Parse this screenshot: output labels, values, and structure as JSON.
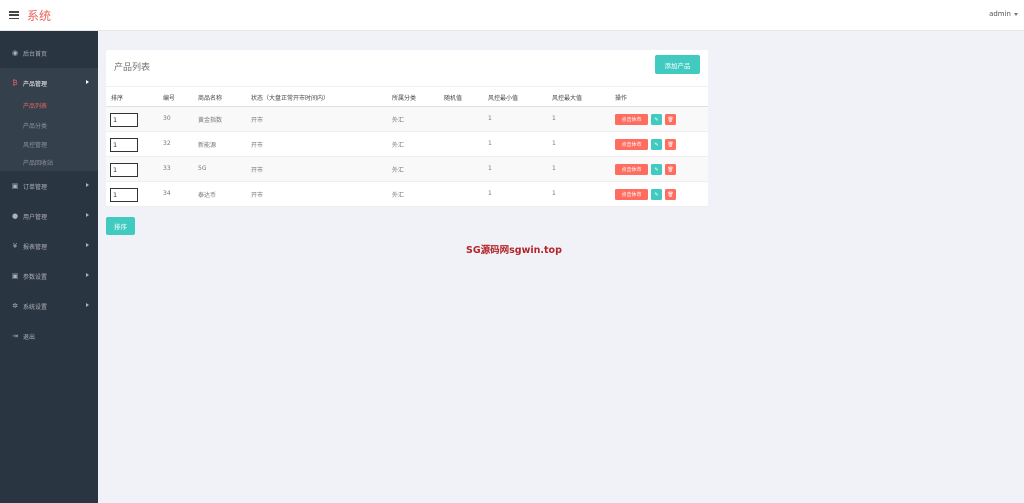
{
  "app": {
    "title": "系统",
    "user": "admin"
  },
  "sidebar": {
    "items": [
      {
        "label": "后台首页",
        "icon": "dashboard-icon",
        "glyph": "◉"
      },
      {
        "label": "产品管理",
        "icon": "product-icon",
        "glyph": "₿",
        "active": true
      },
      {
        "label": "订单管理",
        "icon": "order-icon",
        "glyph": "▣"
      },
      {
        "label": "用户管理",
        "icon": "user-icon",
        "glyph": "●"
      },
      {
        "label": "报表管理",
        "icon": "yen-icon",
        "glyph": "¥"
      },
      {
        "label": "参数设置",
        "icon": "params-icon",
        "glyph": "▣"
      },
      {
        "label": "系统设置",
        "icon": "gears-icon",
        "glyph": "✲"
      },
      {
        "label": "退出",
        "icon": "logout-icon",
        "glyph": "⇥"
      }
    ],
    "submenu": [
      {
        "label": "产品列表",
        "current": true
      },
      {
        "label": "产品分类"
      },
      {
        "label": "风控管理"
      },
      {
        "label": "产品回收站"
      }
    ]
  },
  "panel": {
    "title": "产品列表",
    "add_button": "添加产品",
    "columns": [
      "排序",
      "编号",
      "商品名称",
      "状态（大盘正常开市时间内）",
      "所属分类",
      "随机值",
      "风控最小值",
      "风控最大值",
      "操作"
    ],
    "rows": [
      {
        "sort": "1",
        "id": "30",
        "name": "黄金指数",
        "status": "开市",
        "category": "外汇",
        "random": "",
        "min": "1",
        "max": "1"
      },
      {
        "sort": "1",
        "id": "32",
        "name": "新能源",
        "status": "开市",
        "category": "外汇",
        "random": "",
        "min": "1",
        "max": "1"
      },
      {
        "sort": "1",
        "id": "33",
        "name": "5G",
        "status": "开市",
        "category": "外汇",
        "random": "",
        "min": "1",
        "max": "1"
      },
      {
        "sort": "1",
        "id": "34",
        "name": "泰达币",
        "status": "开市",
        "category": "外汇",
        "random": "",
        "min": "1",
        "max": "1"
      }
    ],
    "rest_button": "点击休市",
    "edit_icon": "✎",
    "delete_icon": "🗑"
  },
  "sort_button": "排序",
  "watermark": "SG源码网sgwin.top",
  "colors": {
    "accent_red": "#e8665a",
    "teal": "#41cac0",
    "sidebar_bg": "#2a3542",
    "danger": "#ff6c60"
  }
}
